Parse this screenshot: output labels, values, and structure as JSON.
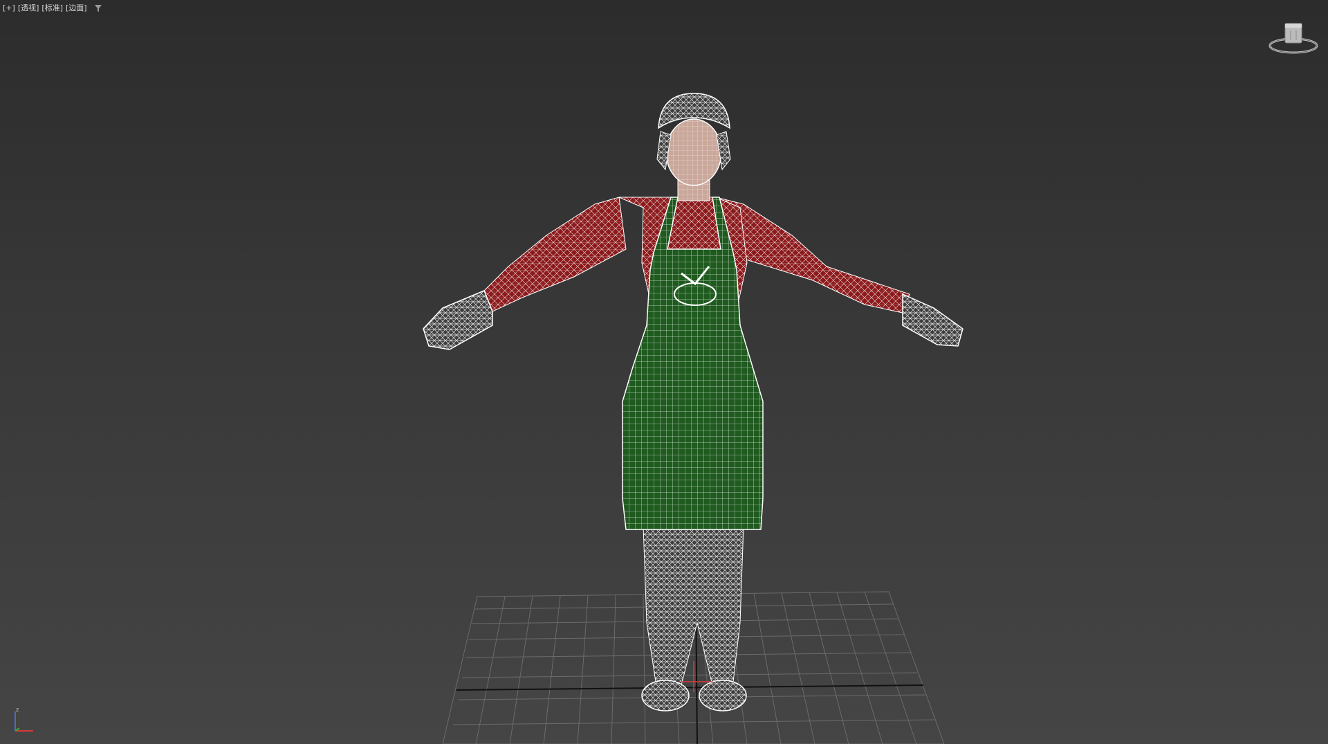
{
  "viewport": {
    "labels": [
      "[+]",
      "[透视]",
      "[标准]",
      "[边面]"
    ],
    "filter_icon": "filter-icon",
    "background_top": "#2c2c2c",
    "background_bottom": "#454545"
  },
  "scene": {
    "grid_color": "#6b6b6b",
    "axis_line_color": "#111111",
    "apron_color": "#1f5a1f",
    "shirt_color": "#b01f22",
    "wire_color": "#f2f2f2"
  },
  "icons": {
    "viewcube": "viewcube-icon",
    "axis": "axis-tripod-icon"
  }
}
